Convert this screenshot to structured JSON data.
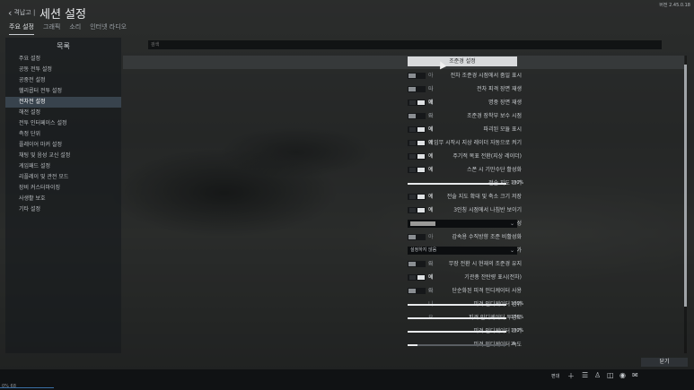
{
  "topbar": {
    "back_label": "격납고 |",
    "title": "세션 설정",
    "version": "버전 2.45.0.18"
  },
  "tabs": [
    "주요 설정",
    "그래픽",
    "소리",
    "인터넷 라디오"
  ],
  "sidebar": {
    "title": "목록",
    "items": [
      "주요 설정",
      "공동 전투 설정",
      "공중전 설정",
      "헬리콥터 전투 설정",
      "전차전 설정",
      "해전 설정",
      "전투 인터페이스 설정",
      "측정 단위",
      "플레이어 마커 설정",
      "채팅 및 음성 교신 설정",
      "게임패드 설정",
      "리플레이 및 관전 모드",
      "장비 커스터마이징",
      "사생활 보호",
      "기타 설정"
    ],
    "selected_index": 4
  },
  "search": {
    "placeholder": "검색"
  },
  "section_button": "조준경 설정",
  "rows": [
    {
      "label": "전차 조준경 시점에서 줌일 표시",
      "type": "toggle",
      "on": false,
      "text": "아니요"
    },
    {
      "label": "전차 피격 장면 재생",
      "type": "toggle",
      "on": false,
      "text": "아니요"
    },
    {
      "label": "명중 장면 재생",
      "type": "toggle",
      "on": true,
      "text": "예"
    },
    {
      "label": "조준경 장착부 보수 시점",
      "type": "toggle",
      "on": false,
      "text": "아니요"
    },
    {
      "label": "파괴된 모듈 표시",
      "type": "toggle",
      "on": true,
      "text": "예"
    },
    {
      "label": "임무 시작시 지상 레이더 자동으로 켜기",
      "type": "toggle",
      "on": true,
      "text": "예"
    },
    {
      "label": "주기적 목표 전환(지상 레이더)",
      "type": "toggle",
      "on": true,
      "text": "예"
    },
    {
      "label": "스폰 시 기만수단 활성화",
      "type": "toggle",
      "on": true,
      "text": "예"
    },
    {
      "label": "전술 지도 크기",
      "type": "slider",
      "value": 100,
      "text": "100%"
    },
    {
      "label": "전술 지도 확대 및 축소 크기 저장",
      "type": "toggle",
      "on": true,
      "text": "예"
    },
    {
      "label": "3인칭 시점에서 나침반 보이기",
      "type": "toggle",
      "on": true,
      "text": "예"
    },
    {
      "label": "열상조준경 색구성",
      "type": "dropdown",
      "text": "",
      "swatch": "#9a9a98"
    },
    {
      "label": "감속용 수직방향 조준 비활성화",
      "type": "toggle",
      "on": false,
      "text": "아니요"
    },
    {
      "label": "시점에 전차장 카메라 추가",
      "type": "dropdown",
      "text": "설정하지 않음"
    },
    {
      "label": "무장 전환 시 현재의 조준경 유지",
      "type": "toggle",
      "on": false,
      "text": "아니요"
    },
    {
      "label": "기관총 잔탄량 표시(전차)",
      "type": "toggle",
      "on": true,
      "text": "예"
    },
    {
      "label": "단순화된 피격 인디케이터 사용",
      "type": "toggle",
      "on": false,
      "text": "아니요"
    },
    {
      "label": "피격 인디케이터 범위",
      "type": "slider",
      "value": 100,
      "text": "100%"
    },
    {
      "label": "피격 인디케이터 투명도",
      "type": "slider",
      "value": 100,
      "text": "100%"
    },
    {
      "label": "피격 인디케이터 크기",
      "type": "slider",
      "value": 100,
      "text": "100%"
    },
    {
      "label": "피격 인디케이터 속도",
      "type": "slider",
      "value": 10,
      "text": "2s"
    }
  ],
  "close_button": "닫기",
  "bottombar": {
    "label": "편대",
    "icons": [
      "plus-icon",
      "list-icon",
      "person-icon",
      "chat-icon",
      "gamepad-icon",
      "mail-icon"
    ],
    "status": "0% 68"
  }
}
